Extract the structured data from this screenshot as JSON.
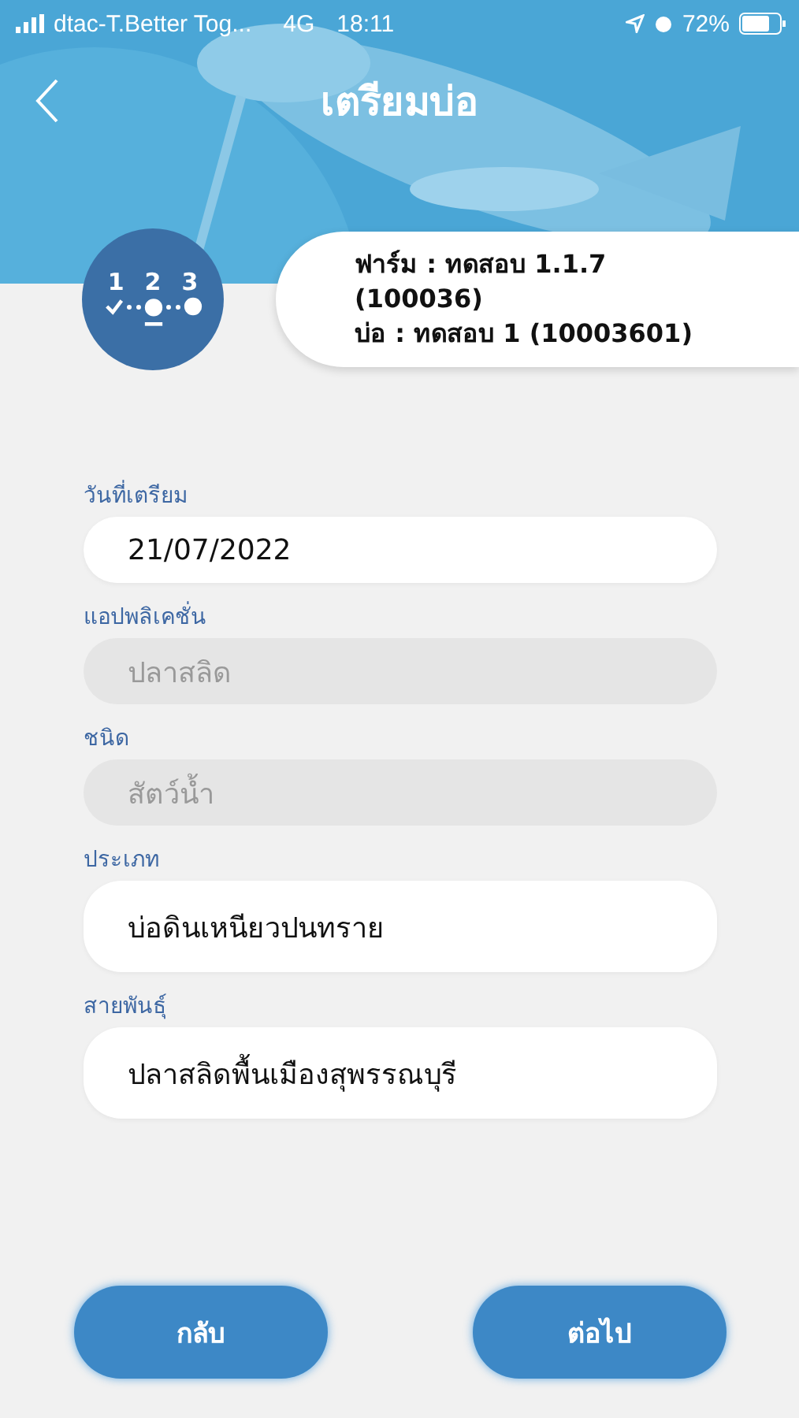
{
  "status_bar": {
    "carrier": "dtac-T.Better Tog...",
    "network": "4G",
    "time": "18:11",
    "battery": "72%"
  },
  "header": {
    "title": "เตรียมบ่อ"
  },
  "steps": [
    {
      "label": "1",
      "done": true,
      "current": false
    },
    {
      "label": "2",
      "done": false,
      "current": true
    },
    {
      "label": "3",
      "done": false,
      "current": false
    }
  ],
  "info": {
    "lines": [
      "ฟาร์ม : ทดสอบ 1.1.7",
      "(100036)",
      "บ่อ : ทดสอบ 1 (10003601)"
    ]
  },
  "fields": [
    {
      "kind": "date",
      "label": "วันที่เตรียม",
      "value": "21/07/2022",
      "disabled": false
    },
    {
      "kind": "text",
      "label": "แอปพลิเคชั่น",
      "value": "ปลาสลิด",
      "disabled": true
    },
    {
      "kind": "text",
      "label": "ชนิด",
      "value": "สัตว์น้ำ",
      "disabled": true
    },
    {
      "kind": "select",
      "label": "ประเภท",
      "value": "บ่อดินเหนียวปนทราย",
      "disabled": false
    },
    {
      "kind": "select",
      "label": "สายพันธุ์",
      "value": "ปลาสลิดพื้นเมืองสุพรรณบุรี",
      "disabled": false
    }
  ],
  "buttons": [
    "กลับ",
    "ต่อไป"
  ]
}
